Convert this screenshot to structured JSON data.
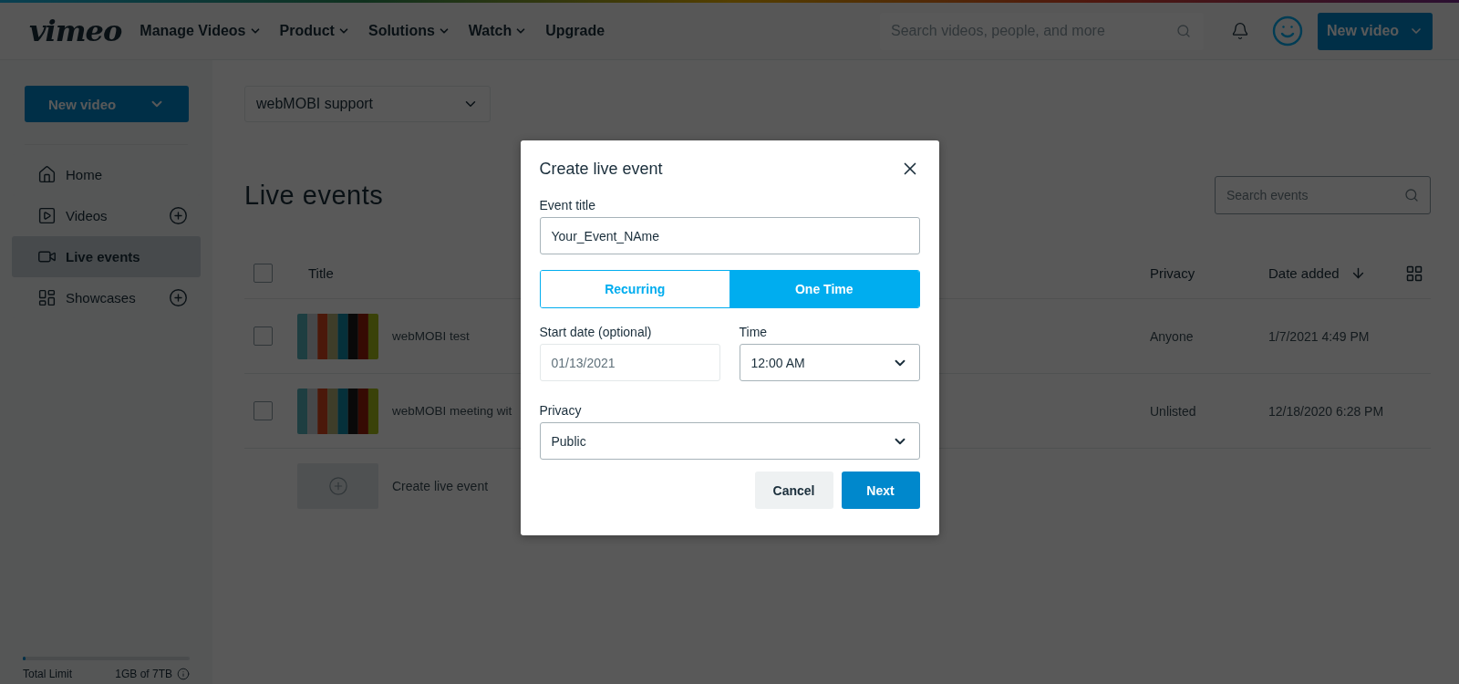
{
  "header": {
    "logo": "vimeo",
    "nav": [
      {
        "label": "Manage Videos",
        "dropdown": true
      },
      {
        "label": "Product",
        "dropdown": true
      },
      {
        "label": "Solutions",
        "dropdown": true
      },
      {
        "label": "Watch",
        "dropdown": true
      },
      {
        "label": "Upgrade",
        "dropdown": false
      }
    ],
    "search": {
      "placeholder": "Search videos, people, and more"
    },
    "new_video": "New video"
  },
  "sidebar": {
    "new_video": "New video",
    "items": [
      {
        "label": "Home",
        "kind": "home",
        "addable": false,
        "selected": false
      },
      {
        "label": "Videos",
        "kind": "videos",
        "addable": true,
        "selected": false
      },
      {
        "label": "Live events",
        "kind": "live",
        "addable": false,
        "selected": true
      },
      {
        "label": "Showcases",
        "kind": "showcases",
        "addable": true,
        "selected": false
      }
    ],
    "storage": {
      "label": "Total Limit",
      "value": "1GB of 7TB",
      "level": 0
    }
  },
  "main": {
    "team": "webMOBI support",
    "title": "Live events",
    "search": {
      "placeholder": "Search events"
    },
    "table": {
      "all_checked": false,
      "columns": [
        "Title",
        "Privacy",
        "Date added"
      ],
      "rows": [
        {
          "checked": false,
          "title": "webMOBI test",
          "privacy": "Anyone",
          "date": "1/7/2021 4:49 PM"
        },
        {
          "checked": false,
          "title": "webMOBI meeting wit",
          "privacy": "Unlisted",
          "date": "12/18/2020 6:28 PM"
        }
      ],
      "create": "Create live event"
    }
  },
  "dialog": {
    "title": "Create live event",
    "fields": {
      "event_title": {
        "label": "Event title",
        "value": "Your_Event_NAme"
      },
      "frequency": [
        {
          "label": "Recurring",
          "selected": false
        },
        {
          "label": "One Time",
          "selected": true
        }
      ],
      "start_date": {
        "label": "Start date (optional)",
        "value": "01/13/2021"
      },
      "time": {
        "label": "Time",
        "value": "12:00 AM"
      },
      "privacy": {
        "label": "Privacy",
        "value": "Public"
      }
    },
    "buttons": [
      {
        "label": "Cancel",
        "kind": "secondary"
      },
      {
        "label": "Next",
        "kind": "primary"
      }
    ]
  }
}
